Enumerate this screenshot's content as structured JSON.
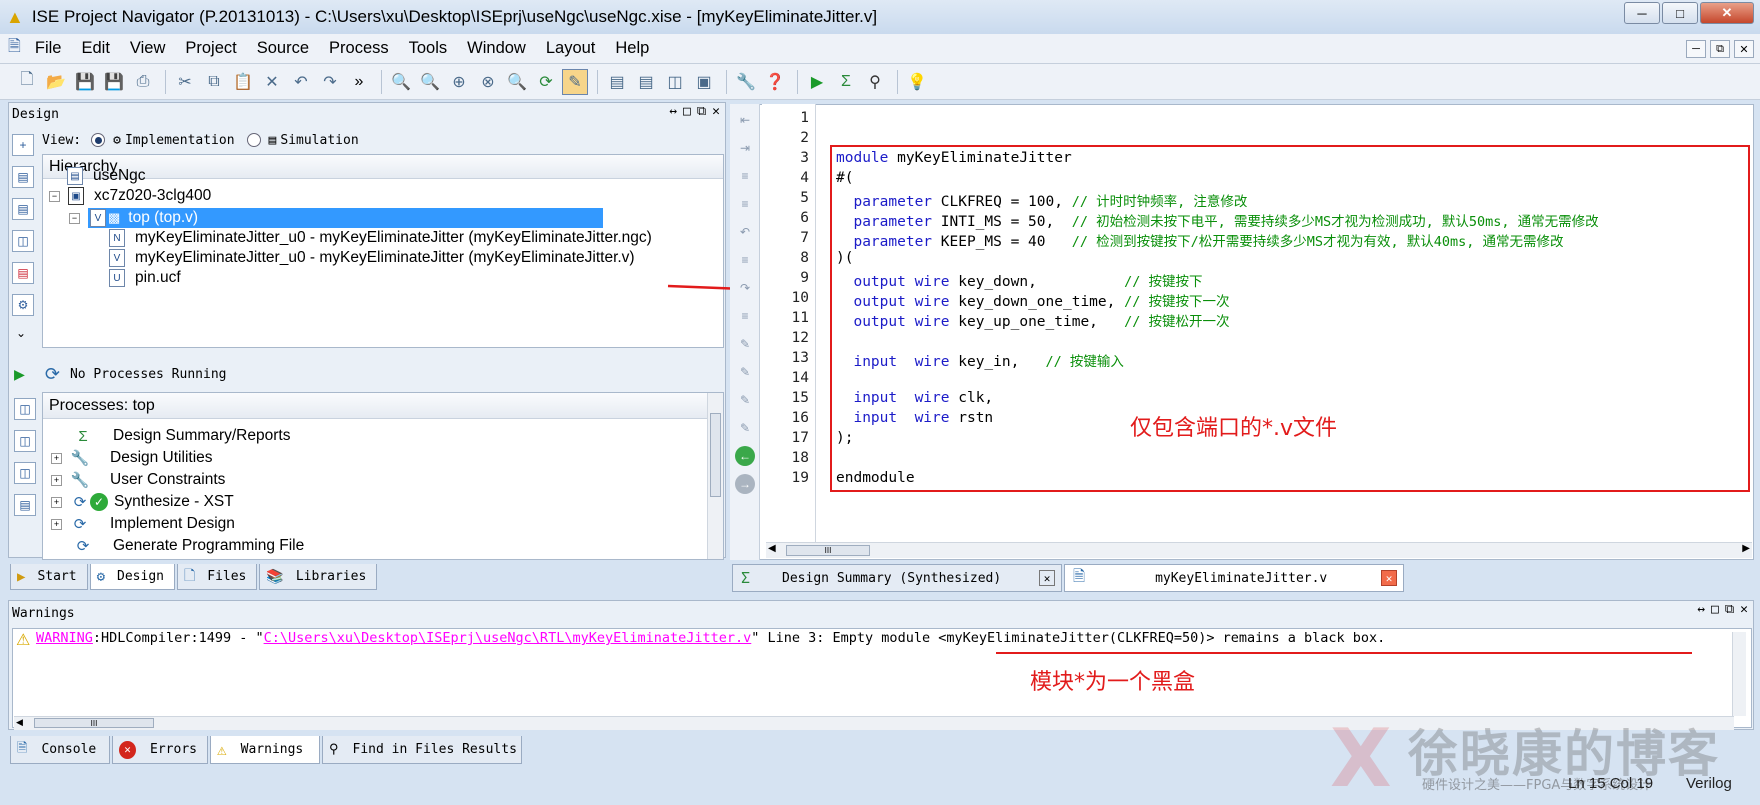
{
  "window": {
    "title": "ISE Project Navigator (P.20131013) - C:\\Users\\xu\\Desktop\\ISEprj\\useNgc\\useNgc.xise - [myKeyEliminateJitter.v]"
  },
  "menu": [
    "File",
    "Edit",
    "View",
    "Project",
    "Source",
    "Process",
    "Tools",
    "Window",
    "Layout",
    "Help"
  ],
  "design_panel": {
    "title": "Design",
    "view_label": "View:",
    "view_options": [
      "Implementation",
      "Simulation"
    ],
    "hierarchy_label": "Hierarchy",
    "tree": [
      "useNgc",
      "xc7z020-3clg400",
      "top (top.v)",
      "myKeyEliminateJitter_u0 - myKeyEliminateJitter (myKeyEliminateJitter.ngc)",
      "myKeyEliminateJitter_u0 - myKeyEliminateJitter (myKeyEliminateJitter.v)",
      "pin.ucf"
    ],
    "no_processes": "No Processes Running",
    "processes_label": "Processes: top",
    "processes": [
      "Design Summary/Reports",
      "Design Utilities",
      "User Constraints",
      "Synthesize - XST",
      "Implement Design",
      "Generate Programming File"
    ]
  },
  "left_tabs": [
    "Start",
    "Design",
    "Files",
    "Libraries"
  ],
  "editor": {
    "line_numbers": [
      "1",
      "2",
      "3",
      "4",
      "5",
      "6",
      "7",
      "8",
      "9",
      "10",
      "11",
      "12",
      "13",
      "14",
      "15",
      "16",
      "17",
      "18",
      "19"
    ],
    "code": {
      "l3a": "module",
      "l3b": " myKeyEliminateJitter",
      "l4": "#(",
      "l5a": "  parameter",
      "l5b": " CLKFREQ = 100, ",
      "l5c": "// 计时时钟频率, 注意修改",
      "l6a": "  parameter",
      "l6b": " INTI_MS = 50,  ",
      "l6c": "// 初始检测未按下电平, 需要持续多少MS才视为检测成功, 默认50ms, 通常无需修改",
      "l7a": "  parameter",
      "l7b": " KEEP_MS = 40   ",
      "l7c": "// 检测到按键按下/松开需要持续多少MS才视为有效, 默认40ms, 通常无需修改",
      "l8": ")(",
      "l9a": "  output wire",
      "l9b": " key_down,          ",
      "l9c": "// 按键按下",
      "l10a": "  output wire",
      "l10b": " key_down_one_time, ",
      "l10c": "// 按键按下一次",
      "l11a": "  output wire",
      "l11b": " key_up_one_time,   ",
      "l11c": "// 按键松开一次",
      "l13a": "  input  wire",
      "l13b": " key_in,   ",
      "l13c": "// 按键输入",
      "l15a": "  input  wire",
      "l15b": " clk,",
      "l16a": "  input  wire",
      "l16b": " rstn",
      "l17": ");",
      "l19": "endmodule"
    },
    "annotation": "仅包含端口的*.v文件"
  },
  "right_tabs": [
    "Design Summary (Synthesized)",
    "myKeyEliminateJitter.v"
  ],
  "warnings": {
    "title": "Warnings",
    "prefix": "WARNING",
    "code": ":HDLCompiler:1499 - \"",
    "path": "C:\\Users\\xu\\Desktop\\ISEprj\\useNgc\\RTL\\myKeyEliminateJitter.v",
    "msg": "\" Line 3: Empty module <myKeyEliminateJitter(CLKFREQ=50)> remains a black box.",
    "annotation": "模块*为一个黑盒"
  },
  "bottom_tabs": [
    "Console",
    "Errors",
    "Warnings",
    "Find in Files Results"
  ],
  "status": {
    "position": "Ln 15 Col 19",
    "language": "Verilog"
  },
  "watermark": {
    "title": "徐晓康的博客",
    "subtitle": "硬件设计之美——FPGA与数字系统设计"
  },
  "colors": {
    "keyword": "#1c1cc8",
    "comment": "#0a8f0a",
    "annotation": "#e21b1b",
    "selection": "#3399ff",
    "link": "#ff00ff"
  }
}
